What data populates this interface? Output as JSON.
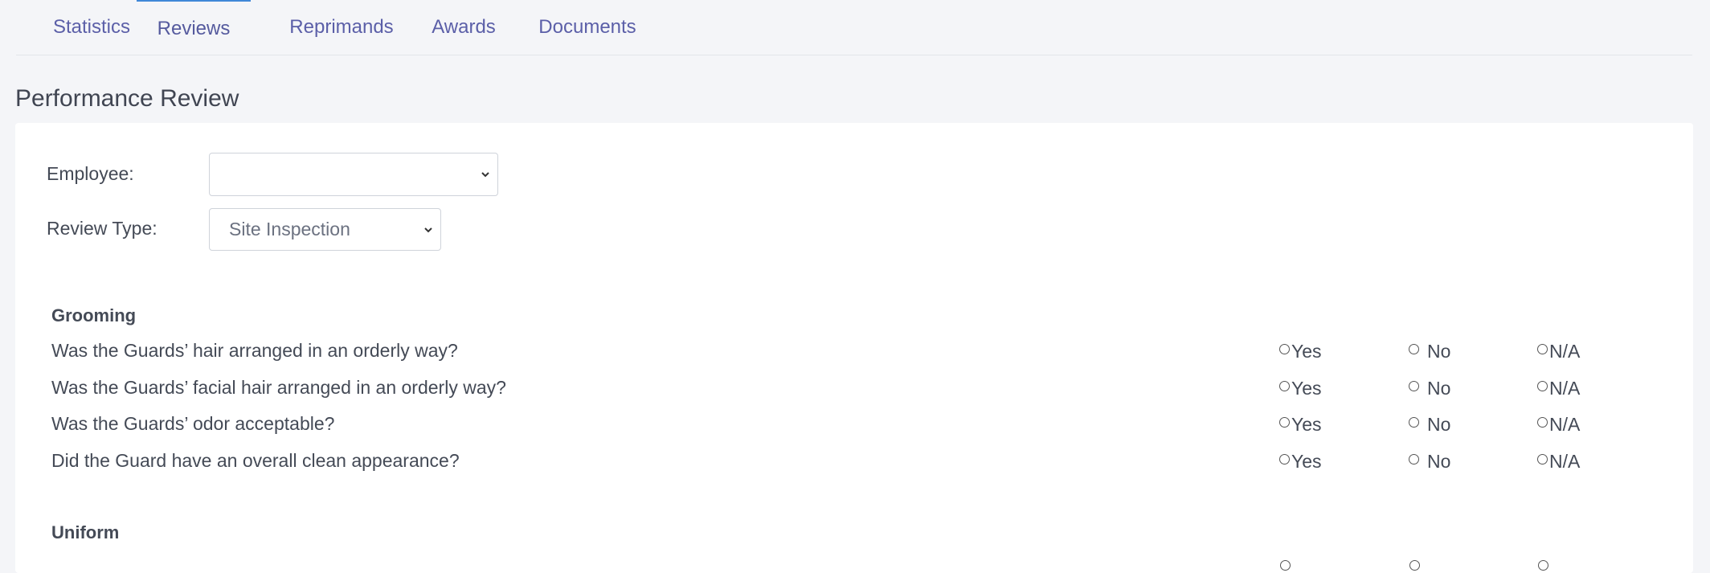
{
  "tabs": [
    {
      "label": "Statistics"
    },
    {
      "label": "Reviews"
    },
    {
      "label": "Reprimands"
    },
    {
      "label": "Awards"
    },
    {
      "label": "Documents"
    }
  ],
  "active_tab": "Reviews",
  "page_title": "Performance Review",
  "form": {
    "employee_label": "Employee:",
    "employee_value": "",
    "review_type_label": "Review Type:",
    "review_type_value": "Site Inspection"
  },
  "sections": [
    {
      "title": "Grooming",
      "questions": [
        "Was the Guards’ hair arranged in an orderly way?",
        "Was the Guards’ facial hair arranged in an orderly way?",
        "Was the Guards’ odor acceptable?",
        "Did the Guard have an overall clean appearance?"
      ]
    },
    {
      "title": "Uniform",
      "questions": []
    }
  ],
  "options": {
    "yes": "Yes",
    "no": "No",
    "na": "N/A"
  }
}
